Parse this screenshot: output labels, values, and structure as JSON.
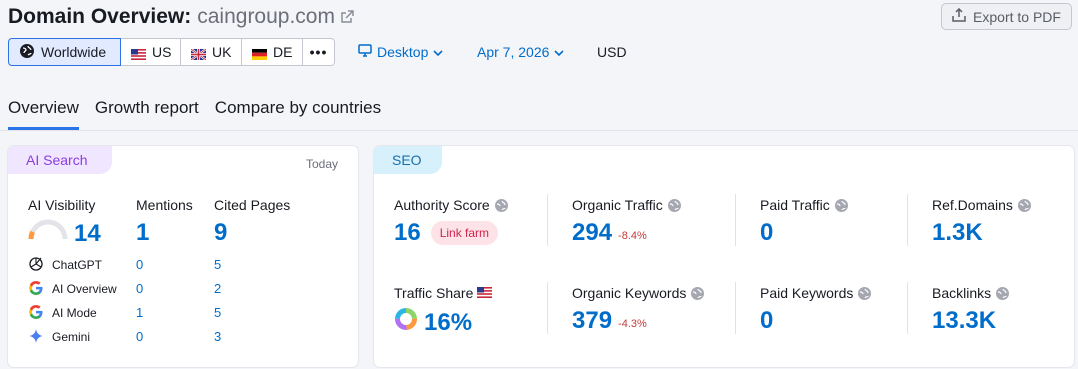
{
  "header": {
    "title": "Domain Overview:",
    "domain": "caingroup.com",
    "export_label": "Export to PDF"
  },
  "filters": {
    "regions": [
      {
        "label": "Worldwide",
        "icon": "globe-icon",
        "active": true
      },
      {
        "label": "US",
        "icon": "us-flag-icon"
      },
      {
        "label": "UK",
        "icon": "uk-flag-icon"
      },
      {
        "label": "DE",
        "icon": "de-flag-icon"
      }
    ],
    "more_label": "•••",
    "device": "Desktop",
    "date": "Apr 7, 2026",
    "currency": "USD"
  },
  "tabs": [
    {
      "label": "Overview",
      "active": true
    },
    {
      "label": "Growth report"
    },
    {
      "label": "Compare by countries"
    }
  ],
  "ai_search": {
    "badge": "AI Search",
    "today": "Today",
    "visibility_label": "AI Visibility",
    "visibility_value": "14",
    "visibility_gauge_fraction": 0.14,
    "mentions_label": "Mentions",
    "mentions_value": "1",
    "cited_label": "Cited Pages",
    "cited_value": "9",
    "rows": [
      {
        "name": "ChatGPT",
        "icon": "chatgpt-icon",
        "mentions": "0",
        "cited": "5"
      },
      {
        "name": "AI Overview",
        "icon": "google-icon",
        "mentions": "0",
        "cited": "2"
      },
      {
        "name": "AI Mode",
        "icon": "google-icon",
        "mentions": "1",
        "cited": "5"
      },
      {
        "name": "Gemini",
        "icon": "gemini-icon",
        "mentions": "0",
        "cited": "3"
      }
    ]
  },
  "seo": {
    "badge": "SEO",
    "authority_score": {
      "label": "Authority Score",
      "value": "16",
      "tag": "Link farm"
    },
    "organic_traffic": {
      "label": "Organic Traffic",
      "value": "294",
      "delta": "-8.4%"
    },
    "paid_traffic": {
      "label": "Paid Traffic",
      "value": "0"
    },
    "ref_domains": {
      "label": "Ref.Domains",
      "value": "1.3K"
    },
    "traffic_share": {
      "label": "Traffic Share",
      "value": "16%"
    },
    "organic_keywords": {
      "label": "Organic Keywords",
      "value": "379",
      "delta": "-4.3%"
    },
    "paid_keywords": {
      "label": "Paid Keywords",
      "value": "0"
    },
    "backlinks": {
      "label": "Backlinks",
      "value": "13.3K"
    }
  },
  "colors": {
    "accent_blue": "#006dca",
    "ai_badge_bg": "#f1e6ff",
    "seo_badge_bg": "#d6f0fc",
    "negative": "#c43a3a"
  }
}
